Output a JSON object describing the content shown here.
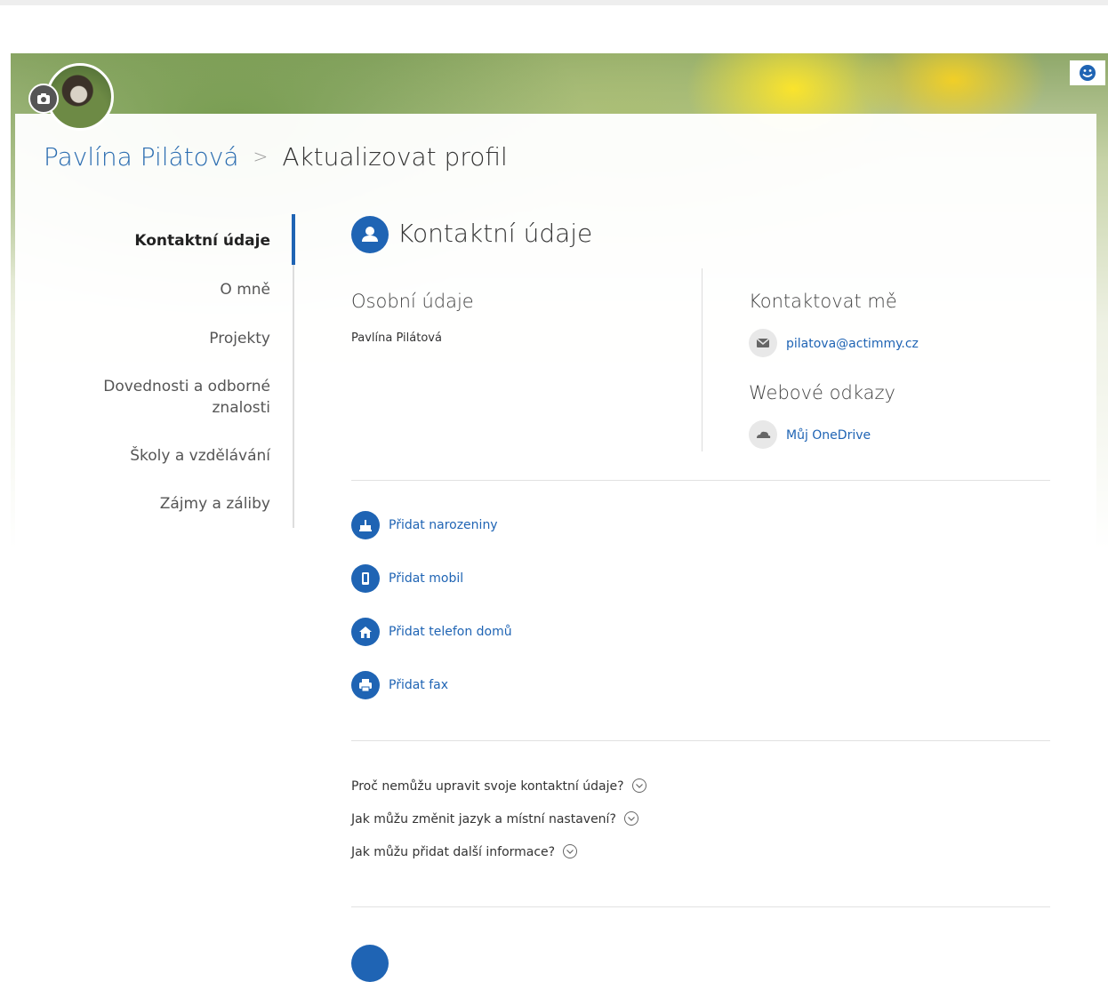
{
  "header": {
    "user_name": "Pavlína Pilátová",
    "separator": ">",
    "page_title": "Aktualizovat profil"
  },
  "sidebar": {
    "items": [
      {
        "label": "Kontaktní údaje",
        "active": true
      },
      {
        "label": "O mně",
        "active": false
      },
      {
        "label": "Projekty",
        "active": false
      },
      {
        "label": "Dovednosti a odborné znalosti",
        "active": false
      },
      {
        "label": "Školy a vzdělávání",
        "active": false
      },
      {
        "label": "Zájmy a záliby",
        "active": false
      }
    ]
  },
  "section": {
    "title": "Kontaktní údaje",
    "icon": "person-icon"
  },
  "personal": {
    "heading": "Osobní údaje",
    "name": "Pavlína Pilátová"
  },
  "contact": {
    "heading": "Kontaktovat mě",
    "email": "pilatova@actimmy.cz",
    "email_icon": "mail-icon",
    "web_heading": "Webové odkazy",
    "onedrive": "Můj OneDrive",
    "onedrive_icon": "cloud-icon"
  },
  "add_actions": [
    {
      "label": "Přidat narozeniny",
      "icon": "birthday-cake-icon"
    },
    {
      "label": "Přidat mobil",
      "icon": "mobile-phone-icon"
    },
    {
      "label": "Přidat telefon domů",
      "icon": "home-icon"
    },
    {
      "label": "Přidat fax",
      "icon": "printer-icon"
    }
  ],
  "faq": [
    "Proč nemůžu upravit svoje kontaktní údaje?",
    "Jak můžu změnit jazyk a místní nastavení?",
    "Jak můžu přidat další informace?"
  ],
  "colors": {
    "accent": "#1f64b4",
    "text": "#333333"
  }
}
